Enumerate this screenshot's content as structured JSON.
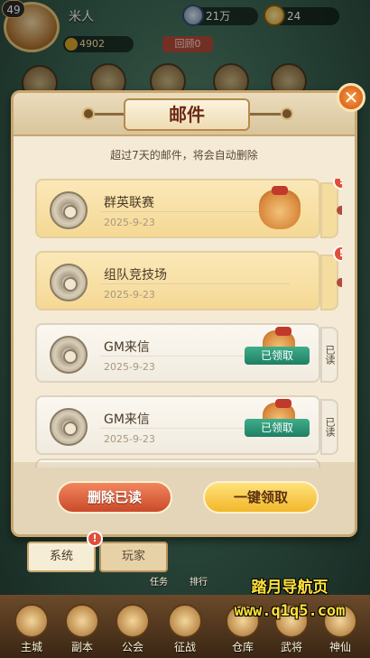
{
  "topbar": {
    "level": "49",
    "player_name": "米人",
    "silver": "21万",
    "gold": "24",
    "power": "4902",
    "badge": "回顾0"
  },
  "dialog": {
    "title": "邮件",
    "hint": "超过7天的邮件，将会自动删除",
    "close_label": "✕",
    "mails": [
      {
        "title": "群英联赛",
        "date": "2025-9-23",
        "status": "unread"
      },
      {
        "title": "组队竞技场",
        "date": "2025-9-23",
        "status": "unread"
      },
      {
        "title": "GM来信",
        "date": "2025-9-23",
        "status": "read",
        "claimed_label": "已领取",
        "side_label": "已读"
      },
      {
        "title": "GM来信",
        "date": "2025-9-23",
        "status": "read",
        "claimed_label": "已领取",
        "side_label": "已读"
      }
    ],
    "delete_read_label": "删除已读",
    "claim_all_label": "一键领取"
  },
  "tabs": {
    "system": "系统",
    "player": "玩家"
  },
  "bottomnav": {
    "items": [
      "主城",
      "副本",
      "公会",
      "征战",
      "仓库",
      "武将",
      "神仙"
    ],
    "small_labels": [
      "任务",
      "排行"
    ]
  },
  "watermark": {
    "line1": "踏月导航页",
    "line2": "www.q1q5.com"
  },
  "colors": {
    "delete_button": "#d95a36",
    "claim_button": "#f6c640",
    "claimed_tag": "#2a9676",
    "notification_dot": "#e14e3a"
  }
}
